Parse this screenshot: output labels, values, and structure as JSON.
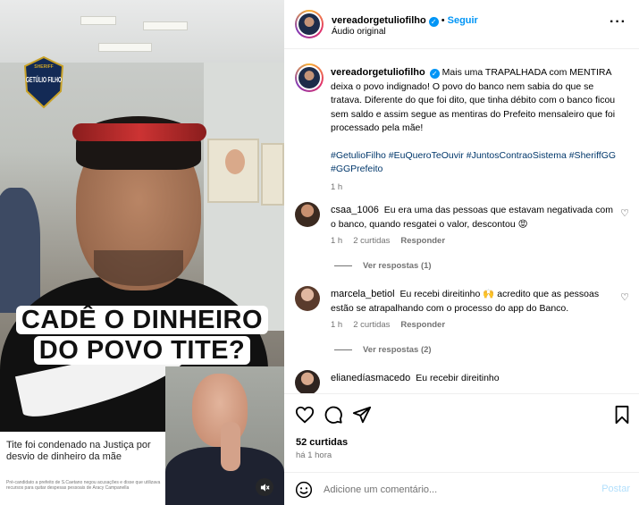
{
  "video": {
    "logo_top": "SHERIFF",
    "logo_main": "GETÚLIO FILHO",
    "caption_line1": "CADÊ O DINHEIRO",
    "caption_line2": "DO POVO TITE?",
    "news_title": "Tite foi condenado na Justiça por desvio de dinheiro da mãe",
    "news_body": "Pré-candidato a prefeito de S.Caetano negou acusações e disse que utilizava recursos para quitar despesas pessoais de Aracy Campanella",
    "mute_icon": "mute-icon"
  },
  "header": {
    "username": "vereadorgetuliofilho",
    "verified": "✓",
    "separator": "•",
    "follow": "Seguir",
    "subtitle": "Áudio original",
    "more": "···"
  },
  "post": {
    "username": "vereadorgetuliofilho",
    "caption": "Mais uma TRAPALHADA com MENTIRA deixa o povo indignado! O povo do banco nem sabia do que se tratava. Diferente do que foi dito, que tinha débito com o banco ficou sem saldo e assim segue as mentiras do Prefeito mensaleiro que foi processado pela mãe!",
    "hashtags": "#GetulioFilho #EuQueroTeOuvir #JuntosContraoSistema #SheriffGG #GGPrefeito",
    "time": "1 h"
  },
  "comments": [
    {
      "username": "csaa_1006",
      "text": "Eu era uma das pessoas que estavam negativada com o banco, quando resgatei o valor, descontou 😡",
      "time": "1 h",
      "likes": "2 curtidas",
      "reply": "Responder",
      "replies": "Ver respostas (1)"
    },
    {
      "username": "marcela_betiol",
      "text": "Eu recebi direitinho 🙌 acredito que as pessoas estão se atrapalhando com o processo do app do Banco.",
      "time": "1 h",
      "likes": "2 curtidas",
      "reply": "Responder",
      "replies": "Ver respostas (2)"
    },
    {
      "username": "elianedíasmacedo",
      "text": "Eu recebir direitinho"
    }
  ],
  "actions": {
    "likes": "52 curtidas",
    "ago": "há 1 hora"
  },
  "comment_bar": {
    "placeholder": "Adicione um comentário...",
    "post": "Postar"
  },
  "colors": {
    "accent": "#0095f6",
    "hashtag": "#00376b",
    "muted": "#737373"
  }
}
